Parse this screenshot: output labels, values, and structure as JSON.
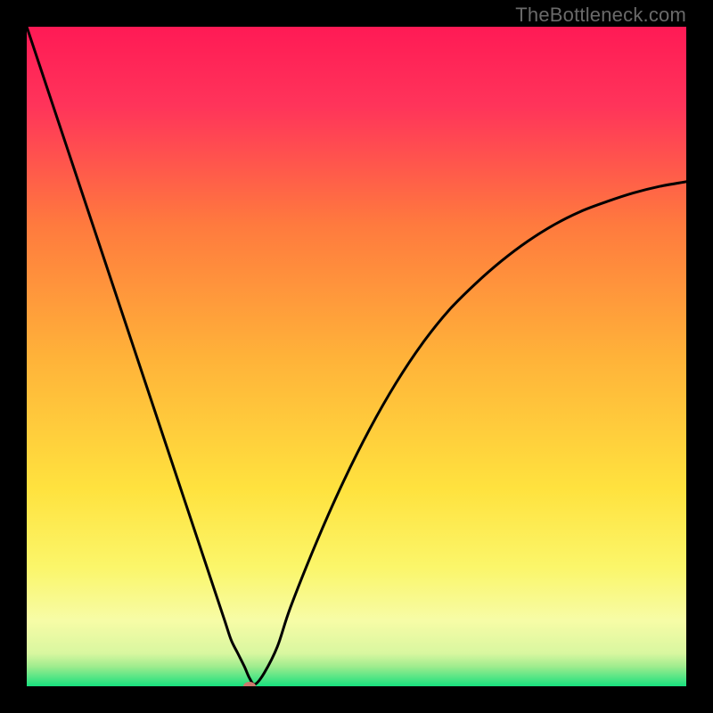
{
  "watermark": "TheBottleneck.com",
  "chart_data": {
    "type": "line",
    "title": "",
    "xlabel": "",
    "ylabel": "",
    "xlim": [
      0,
      100
    ],
    "ylim": [
      0,
      100
    ],
    "grid": false,
    "legend": false,
    "background_gradient_stops": [
      {
        "pct": 0,
        "color": "#ff1a55"
      },
      {
        "pct": 12,
        "color": "#ff345a"
      },
      {
        "pct": 30,
        "color": "#ff7a3e"
      },
      {
        "pct": 50,
        "color": "#ffb239"
      },
      {
        "pct": 70,
        "color": "#ffe23e"
      },
      {
        "pct": 82,
        "color": "#fbf66a"
      },
      {
        "pct": 90,
        "color": "#f7fca6"
      },
      {
        "pct": 95,
        "color": "#d9f7a0"
      },
      {
        "pct": 97,
        "color": "#9fec8e"
      },
      {
        "pct": 100,
        "color": "#18e07e"
      }
    ],
    "series": [
      {
        "name": "bottleneck-curve",
        "color": "#000000",
        "x": [
          0,
          2,
          4,
          6,
          8,
          10,
          12,
          14,
          16,
          18,
          20,
          22,
          24,
          26,
          28,
          30,
          31,
          32,
          33,
          33.8,
          34.6,
          36,
          38,
          40,
          44,
          48,
          52,
          56,
          60,
          64,
          68,
          72,
          76,
          80,
          84,
          88,
          92,
          96,
          100
        ],
        "y": [
          100,
          94,
          88,
          82,
          76,
          70,
          64,
          58,
          52,
          46,
          40,
          34,
          28,
          22,
          16,
          10,
          7,
          5,
          3,
          1.2,
          0.3,
          2,
          6,
          12,
          22,
          31,
          39,
          46,
          52,
          57,
          61,
          64.5,
          67.5,
          70,
          72,
          73.5,
          74.8,
          75.8,
          76.5
        ]
      }
    ],
    "marker": {
      "x": 33.8,
      "y": 0.0,
      "color": "#cc7a6e",
      "rx": 7,
      "ry": 5
    }
  }
}
